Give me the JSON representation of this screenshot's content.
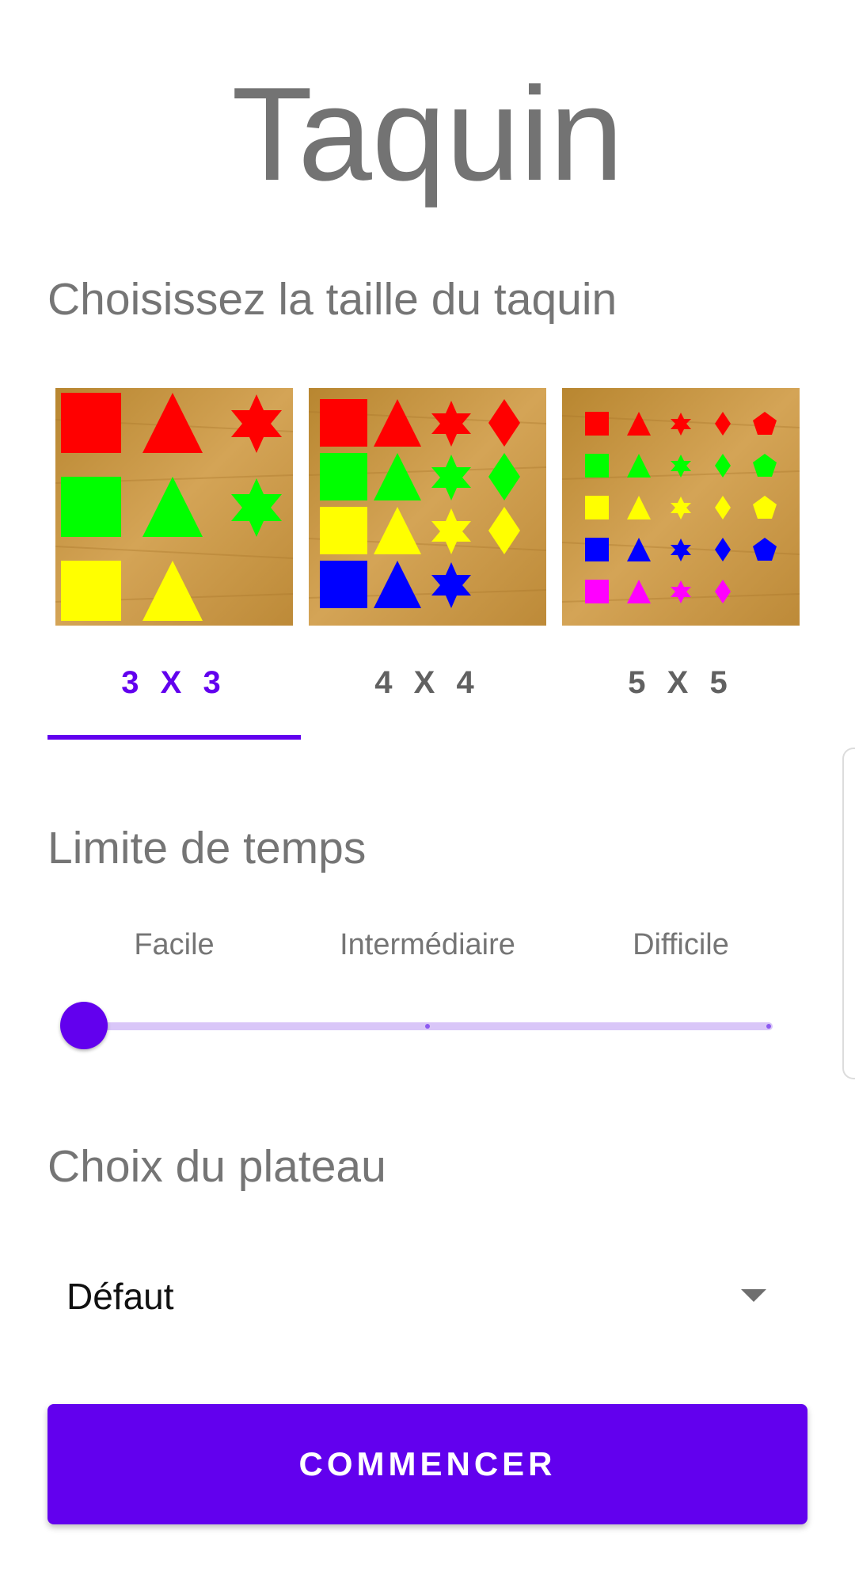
{
  "app": {
    "title": "Taquin"
  },
  "size_section": {
    "title": "Choisissez la taille du taquin",
    "tabs": [
      {
        "label": "3 X 3",
        "icon": "shapes-3x3-board",
        "selected": true
      },
      {
        "label": "4 X 4",
        "icon": "shapes-4x4-board",
        "selected": false
      },
      {
        "label": "5 X 5",
        "icon": "shapes-5x5-board",
        "selected": false
      }
    ]
  },
  "time_section": {
    "title": "Limite de temps",
    "levels": [
      "Facile",
      "Intermédiaire",
      "Difficile"
    ],
    "selected_index": 0
  },
  "board_section": {
    "title": "Choix du plateau",
    "selected": "Défaut"
  },
  "start_button": {
    "label": "COMMENCER"
  },
  "colors": {
    "accent": "#6200ee",
    "track": "#d9c6f8",
    "wood": "#c9963f",
    "red": "#ff0000",
    "green": "#00ff00",
    "yellow": "#ffff00",
    "blue": "#0000ff",
    "magenta": "#ff00ff"
  }
}
